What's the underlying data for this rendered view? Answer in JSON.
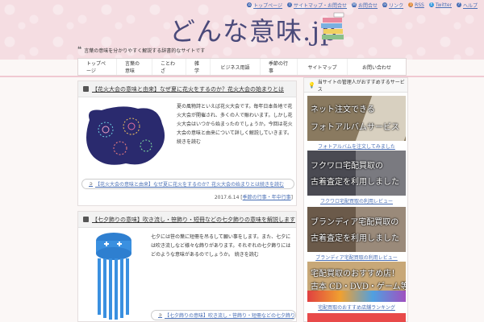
{
  "header": {
    "logo": "どんな意味.jp",
    "tagline": "言葉の意味を分かりやすく解説する辞書的なサイトです",
    "top_links": [
      {
        "icon": "home-icon",
        "label": "トップページ"
      },
      {
        "icon": "info-icon",
        "label": "サイトマップ・お問合せ"
      },
      {
        "icon": "mail-icon",
        "label": "お問合せ"
      },
      {
        "icon": "link-icon",
        "label": "リンク"
      },
      {
        "icon": "rss-icon",
        "label": "RSS"
      },
      {
        "icon": "twitter-icon",
        "label": "Twitter"
      },
      {
        "icon": "question-icon",
        "label": "ヘルプ"
      }
    ]
  },
  "nav": {
    "items": [
      "トップページ",
      "言葉の意味",
      "ことわざ",
      "雑学",
      "ビジネス用語",
      "季節の行事",
      "サイトマップ",
      "お問い合わせ"
    ]
  },
  "posts": [
    {
      "title": "【花火大会の意味と由来】なぜ夏に花火をするのか？花火大会の始まりとは",
      "excerpt": "夏の風物詩といえば花火大会です。毎年日本各地で花火大会が開催され、多くの人で賑わいます。しかし花火大会はいつから始まったのでしょうか。今回は花火大会の意味と由来について詳しく解説していきます。 続きを読む",
      "more": "【花火大会の意味と由来】なぜ夏に花火をするのか？花火大会の始まりとは続きを読む",
      "date": "2017.6.14",
      "category": "季節の行事・年中行事"
    },
    {
      "title": "【七夕飾りの意味】吹き流し・笹飾り・短冊などの七夕飾りの意味を解説します",
      "excerpt": "七夕には笹の葉に短冊を吊るして願い事をします。また、七夕には吹き流しなど様々な飾りがあります。それぞれの七夕飾りにはどのような意味があるのでしょうか。 続きを読む",
      "more": "【七夕飾りの意味】吹き流し・笹飾り・短冊などの七夕飾りの意味を解説します"
    }
  ],
  "sidebar": {
    "heading": "当サイトの管理人がおすすめするサービス",
    "banners": [
      {
        "text1": "ネット注文できる",
        "text2": "フォトアルバムサービス",
        "caption": "フォトアルバムを注文してみました",
        "bg": "#8a7a60"
      },
      {
        "text1": "フクワロ宅配買取の",
        "text2": "古着査定を利用しました",
        "caption": "フクワロ宅配買取の利用レビュー",
        "bg": "#4a4a52"
      },
      {
        "text1": "ブランディア宅配買取の",
        "text2": "古着査定を利用しました",
        "caption": "ブランディア宅配買取の利用レビュー",
        "bg": "#6b5a4a"
      },
      {
        "text1": "宅配買取のおすすめ店！",
        "text2": "古本 CD・DVD・ゲーム等",
        "caption": "宅配買取のおすすめ店舗ランキング",
        "bg": "#c8a878"
      }
    ]
  }
}
